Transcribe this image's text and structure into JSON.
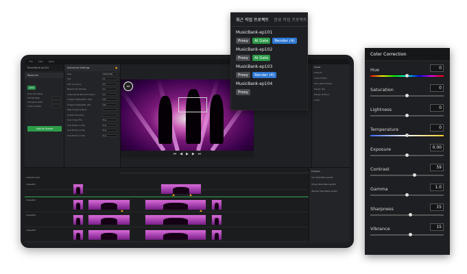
{
  "device": {
    "menu": [
      "File",
      "Edit",
      "View"
    ],
    "left_title": "MusicBank-ep104",
    "left_section": "Resource",
    "left_chip": "Add",
    "left_rows": [
      {
        "label": "Scan Encoding"
      },
      {
        "label": "Set Bit Rate"
      },
      {
        "label": "Sampling Rate"
      },
      {
        "label": "Video Quality"
      }
    ],
    "add_button": "Add to Queue",
    "settings_title": "Advanced Settings",
    "settings_rows": [
      {
        "label": "Size",
        "value": "1920x1080"
      },
      {
        "label": "Fps",
        "value": "30"
      },
      {
        "label": "CRF Accuracy",
        "value": "0.0"
      },
      {
        "label": "Bitrate Min Bitrate",
        "value": "0.0"
      },
      {
        "label": "Video Mode Bit Information",
        "value": "0.0"
      },
      {
        "label": "Image Quality(JPG, 100)",
        "value": "100"
      },
      {
        "label": "Image Quality(JPG, 90)",
        "value": "100"
      },
      {
        "label": "Map Image Output",
        "value": ""
      },
      {
        "label": "Output Directory",
        "value": ""
      },
      {
        "label": "Use Image File",
        "value": "True"
      },
      {
        "label": "Use Media, to file",
        "value": "True"
      },
      {
        "label": "Use Media, to file",
        "value": "True"
      },
      {
        "label": "Use Media, to file",
        "value": "True"
      }
    ],
    "preview_logo": "MB",
    "time_start": "00:01:23",
    "time_end": "00:04:10",
    "prop_title": "Preset",
    "prop_rows": [
      {
        "label": "Default"
      },
      {
        "label": "Aspect Ratio"
      },
      {
        "label": "Face Select Mode"
      },
      {
        "label": "Margin Top"
      },
      {
        "label": "Margin Bottom"
      },
      {
        "label": "Scale"
      }
    ],
    "progress_title": "Progress",
    "progress_items": [
      "(41) MusicBank-ep101",
      "(Proxy) MusicBank-ep102",
      "(Render) MusicBank-ep103"
    ],
    "track_names": [
      "ClipsetA.mp4",
      "Clipset01",
      "Clipset02",
      "Clipset03",
      "Clipset04"
    ],
    "bottom_center": "Analysis Edit",
    "bottom_right": "Version 0.1.1"
  },
  "popup": {
    "tab_active": "최근 작업 프로젝트",
    "tab_inactive": "완료 작업 프로젝트",
    "projects": [
      {
        "name": "MusicBank-ep101",
        "chips": [
          {
            "label": "Proxy",
            "color": "#4a4b4f"
          },
          {
            "label": "AI Gate",
            "color": "#2e9a4b"
          },
          {
            "label": "Render (4)",
            "color": "#2f78d4"
          }
        ]
      },
      {
        "name": "MusicBank-ep102",
        "chips": [
          {
            "label": "Proxy",
            "color": "#4a4b4f"
          },
          {
            "label": "AI Gate",
            "color": "#2e9a4b"
          }
        ]
      },
      {
        "name": "MusicBank-ep103",
        "chips": [
          {
            "label": "Proxy",
            "color": "#4a4b4f"
          },
          {
            "label": "Render (4)",
            "color": "#2f78d4"
          }
        ]
      },
      {
        "name": "MusicBank-ep104",
        "chips": [
          {
            "label": "Proxy",
            "color": "#4a4b4f"
          }
        ]
      }
    ]
  },
  "color_correction": {
    "title": "Color Correction",
    "controls": [
      {
        "label": "Hue",
        "value": "0",
        "level": 0.5,
        "track": "hue"
      },
      {
        "label": "Saturation",
        "value": "0",
        "level": 0.5,
        "track": "gray"
      },
      {
        "label": "Lightness",
        "value": "0",
        "level": 0.5,
        "track": "gray"
      },
      {
        "label": "Temperature",
        "value": "0",
        "level": 0.5,
        "track": "temp"
      },
      {
        "label": "Exposure",
        "value": "0.00",
        "level": 0.5,
        "track": "gray"
      },
      {
        "label": "Contrast",
        "value": "59",
        "level": 0.6,
        "track": "gray"
      },
      {
        "label": "Gamma",
        "value": "1.0",
        "level": 0.5,
        "track": "gray"
      },
      {
        "label": "Sharpness",
        "value": "15",
        "level": 0.55,
        "track": "gray"
      },
      {
        "label": "Vibrance",
        "value": "15",
        "level": 0.55,
        "track": "gray"
      }
    ]
  }
}
